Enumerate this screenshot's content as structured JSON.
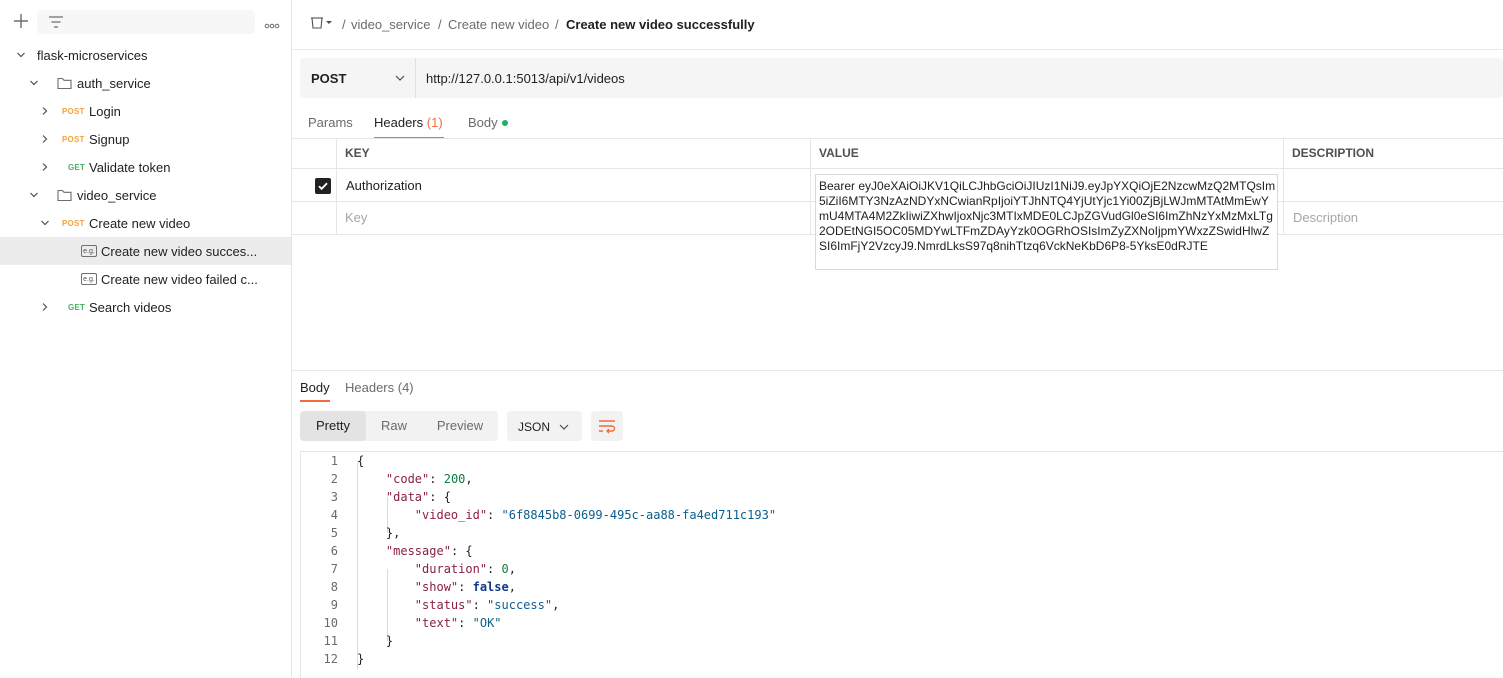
{
  "sidebar": {
    "collection": "flask-microservices",
    "items": [
      {
        "type": "folder",
        "label": "auth_service"
      },
      {
        "type": "request",
        "method": "POST",
        "label": "Login"
      },
      {
        "type": "request",
        "method": "POST",
        "label": "Signup"
      },
      {
        "type": "request",
        "method": "GET",
        "label": "Validate token"
      },
      {
        "type": "folder",
        "label": "video_service"
      },
      {
        "type": "request",
        "method": "POST",
        "label": "Create new video"
      },
      {
        "type": "example",
        "label": "Create new video succes..."
      },
      {
        "type": "example",
        "label": "Create new video failed c..."
      },
      {
        "type": "request",
        "method": "GET",
        "label": "Search videos"
      }
    ]
  },
  "breadcrumb": {
    "sep": "/",
    "folder": "video_service",
    "request": "Create new video",
    "current": "Create new video successfully"
  },
  "request": {
    "method": "POST",
    "url": "http://127.0.0.1:5013/api/v1/videos",
    "tabs": {
      "params": "Params",
      "headers": "Headers",
      "headers_count": "(1)",
      "body": "Body"
    },
    "headers_table": {
      "columns": {
        "key": "KEY",
        "value": "VALUE",
        "description": "DESCRIPTION"
      },
      "rows": [
        {
          "enabled": true,
          "key": "Authorization",
          "value": "Bearer eyJ0eXAiOiJKV1QiLCJhbGciOiJIUzI1NiJ9.eyJpYXQiOjE2NzcwMzQ2MTQsIm5iZiI6MTY3NzAzNDYxNCwianRpIjoiYTJhNTQ4YjUtYjc1Yi00ZjBjLWJmMTAtMmEwYmU4MTA4M2ZkIiwiZXhwIjoxNjc3MTIxMDE0LCJpZGVudGl0eSI6ImZhNzYxMzMxLTg2ODEtNGI5OC05MDYwLTFmZDAyYzk0OGRhOSIsImZyZXNoIjpmYWxzZSwidHlwZSI6ImFjY2VzcyJ9.NmrdLksS97q8nihTtzq6VckNeKbD6P8-5YksE0dRJTE"
        }
      ],
      "placeholders": {
        "key": "Key",
        "description": "Description"
      }
    }
  },
  "response": {
    "tabs": {
      "body": "Body",
      "headers": "Headers (4)"
    },
    "formats": {
      "pretty": "Pretty",
      "raw": "Raw",
      "preview": "Preview"
    },
    "language": "JSON",
    "body": {
      "code": 200,
      "data": {
        "video_id": "6f8845b8-0699-495c-aa88-fa4ed711c193"
      },
      "message": {
        "duration": 0,
        "show": false,
        "status": "success",
        "text": "OK"
      }
    }
  },
  "colors": {
    "accent": "#f26b3a",
    "post": "#f2a33a",
    "get": "#47b05e",
    "body_dot": "#1fb35c"
  }
}
